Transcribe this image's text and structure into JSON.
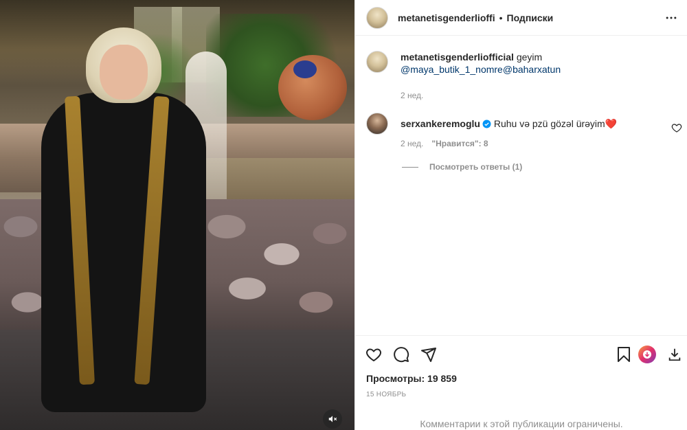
{
  "post": {
    "author": "metanetisgenderlioffi",
    "separator": "•",
    "follow_status": "Подписки",
    "more_icon": "more-horizontal-icon"
  },
  "caption": {
    "author": "metanetisgenderliofficial",
    "text": "geyim",
    "mention1": "@maya_butik_1_nomre",
    "mention2": "@baharxatun",
    "time": "2 нед."
  },
  "comment": {
    "author": "serxankeremoglu",
    "text": "Ruhu və pzü gözəl ürəyim",
    "emoji": "❤️",
    "time": "2 нед.",
    "likes": "\"Нравится\": 8",
    "view_replies": "Посмотреть ответы (1)"
  },
  "actions": {
    "like_icon": "heart-icon",
    "comment_icon": "comment-icon",
    "share_icon": "send-icon",
    "save_icon": "bookmark-icon",
    "views_label": "Просмотры: 19 859",
    "date": "15 НОЯБРЬ",
    "restricted_notice": "Комментарии к этой публикации ограничены."
  },
  "media": {
    "mute_icon": "speaker-muted-icon"
  },
  "colors": {
    "text": "#262626",
    "secondary": "#8e8e8e",
    "link": "#00376b",
    "border": "#efefef",
    "verified": "#0095f6",
    "heart": "#ed4956"
  }
}
